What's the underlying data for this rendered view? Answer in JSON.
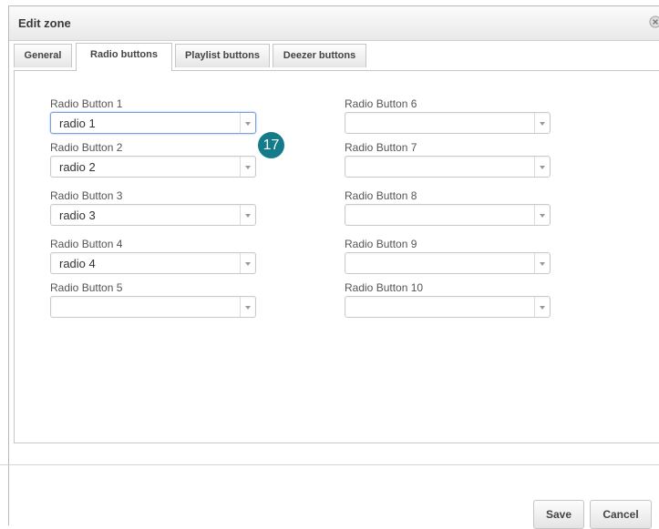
{
  "dialog": {
    "title": "Edit zone",
    "close_icon": "close-circle-icon"
  },
  "tabs": [
    {
      "label": "General",
      "active": false
    },
    {
      "label": "Radio buttons",
      "active": true
    },
    {
      "label": "Playlist buttons",
      "active": false
    },
    {
      "label": "Deezer buttons",
      "active": false
    }
  ],
  "fields": [
    {
      "label": "Radio Button 1",
      "value": "radio 1"
    },
    {
      "label": "Radio Button 2",
      "value": "radio 2"
    },
    {
      "label": "Radio Button 3",
      "value": "radio 3"
    },
    {
      "label": "Radio Button 4",
      "value": "radio 4"
    },
    {
      "label": "Radio Button 5",
      "value": ""
    },
    {
      "label": "Radio Button 6",
      "value": ""
    },
    {
      "label": "Radio Button 7",
      "value": ""
    },
    {
      "label": "Radio Button 8",
      "value": ""
    },
    {
      "label": "Radio Button 9",
      "value": ""
    },
    {
      "label": "Radio Button 10",
      "value": ""
    }
  ],
  "badge": "17",
  "footer": {
    "save_label": "Save",
    "cancel_label": "Cancel"
  },
  "colors": {
    "badge": "#137b8a",
    "focus_border": "#7aa4cf"
  }
}
